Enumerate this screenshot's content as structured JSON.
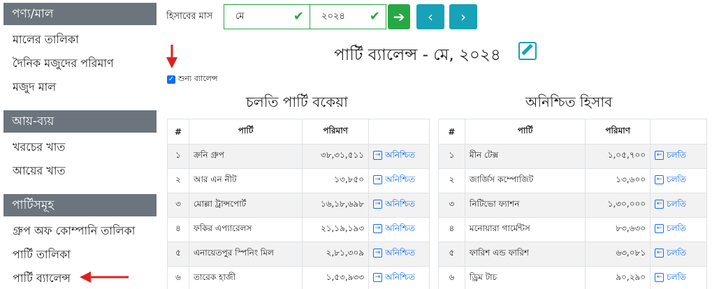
{
  "sidebar": {
    "sections": [
      {
        "title": "পণ্য/মাল",
        "items": [
          "মালের তালিকা",
          "দৈনিক মজুদের পরিমাণ",
          "মজুদ মাল"
        ]
      },
      {
        "title": "আয়-ব্যয়",
        "items": [
          "খরচের খাত",
          "আয়ের খাত"
        ]
      },
      {
        "title": "পার্টিসমূহ",
        "items": [
          "গ্রুপ অফ কোম্পানি তালিকা",
          "পার্টি তালিকা",
          "পার্টি ব্যালেন্স"
        ]
      }
    ]
  },
  "toolbar": {
    "month_label": "হিসাবের মাস",
    "month_value": "মে",
    "year_value": "২০২৪",
    "go_icon": "arrow-right-icon",
    "prev_icon": "chevron-left-icon",
    "next_icon": "chevron-right-icon"
  },
  "page_title": "পার্টি ব্যালেন্স - মে, ২০২৪",
  "zero_balance_label": "শুন্য ব্যালেন্স",
  "left_section": {
    "title": "চলতি পার্টি বকেয়া",
    "headers": [
      "#",
      "পার্টি",
      "পরিমাণ",
      ""
    ],
    "rows": [
      {
        "no": "১",
        "party": "ক্রনি গ্রুপ",
        "amount": "৩৮,৩১,৫১১",
        "action": "অনিশ্চিত"
      },
      {
        "no": "২",
        "party": "আর এন নীট",
        "amount": "১৩,৮৫০",
        "action": "অনিশ্চিত"
      },
      {
        "no": "৩",
        "party": "মোল্লা ট্রান্সপোর্ট",
        "amount": "১৬,১৮,৬৯৮",
        "action": "অনিশ্চিত"
      },
      {
        "no": "৪",
        "party": "ফকির এপ্যারেলস",
        "amount": "২১,১৯,১৯৩",
        "action": "অনিশ্চিত"
      },
      {
        "no": "৫",
        "party": "এনায়েতপুর স্পিনিং মিল",
        "amount": "২,৮১,৩০৯",
        "action": "অনিশ্চিত"
      },
      {
        "no": "৬",
        "party": "তারেক হাজী",
        "amount": "১,৫৩,৯৩৩",
        "action": "অনিশ্চিত"
      }
    ]
  },
  "right_section": {
    "title": "অনিশ্চিত হিসাব",
    "headers": [
      "#",
      "পার্টি",
      "পরিমাণ",
      ""
    ],
    "rows": [
      {
        "no": "১",
        "party": "মীন টেক্স",
        "amount": "১,০৫,৭০০",
        "action": "চলতি"
      },
      {
        "no": "২",
        "party": "জার্জিস কম্পোজিট",
        "amount": "১৩,৬০০",
        "action": "চলতি"
      },
      {
        "no": "৩",
        "party": "নিটিভো ফ্যাশন",
        "amount": "১,৩০,০০০",
        "action": "চলতি"
      },
      {
        "no": "৪",
        "party": "মনোয়ারা গার্মেন্টস",
        "amount": "৮৩,৬৩০",
        "action": "চলতি"
      },
      {
        "no": "৫",
        "party": "ফারিশ এন্ড ফারিশ",
        "amount": "৬৩,০৮১",
        "action": "চলতি"
      },
      {
        "no": "৬",
        "party": "ড্রিম টাচ",
        "amount": "৯০,২৯০",
        "action": "চলতি"
      }
    ]
  },
  "colors": {
    "accent_green": "#28a745",
    "accent_teal": "#17a2b8",
    "annotation_red": "#e02020",
    "link_blue": "#0d6efd"
  }
}
